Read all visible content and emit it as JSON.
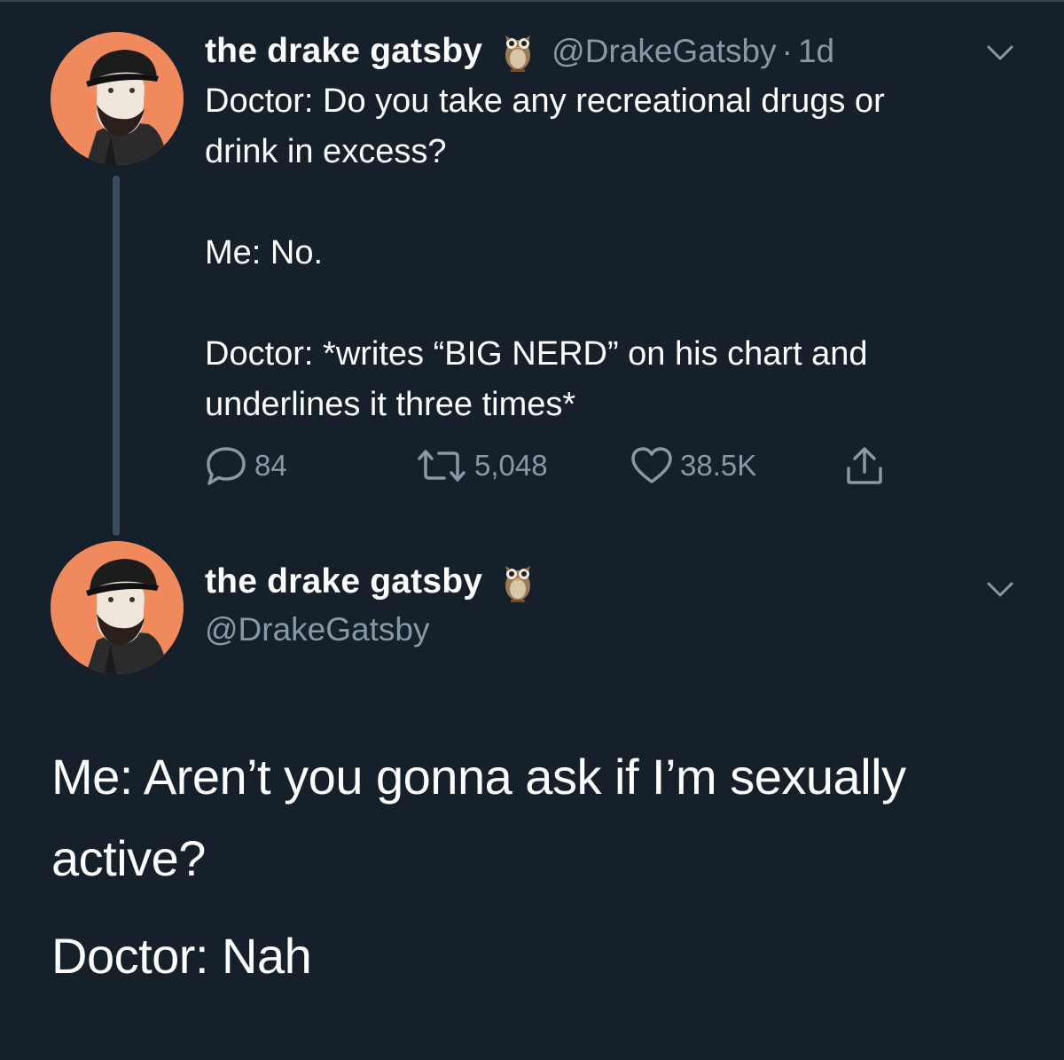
{
  "tweet1": {
    "display_name": "the drake gatsby",
    "emoji_icon": "owl-icon",
    "handle": "@DrakeGatsby",
    "separator": "·",
    "time": "1d",
    "text_lines": [
      "Doctor: Do you take any recreational drugs or",
      "drink in excess?",
      "",
      "Me: No.",
      "",
      "Doctor: *writes “BIG NERD” on his chart and",
      "underlines it three times*"
    ],
    "actions": {
      "replies": "84",
      "retweets": "5,048",
      "likes": "38.5K"
    }
  },
  "tweet2": {
    "display_name": "the drake gatsby",
    "emoji_icon": "owl-icon",
    "handle": "@DrakeGatsby",
    "text_lines": [
      "Me: Aren’t you gonna ask if I’m sexually",
      "active?",
      "Doctor: Nah"
    ]
  },
  "colors": {
    "background": "#15202b",
    "text": "#ffffff",
    "secondary": "#8899a6",
    "avatar_bg": "#f08a5d",
    "thread_line": "#3a4d60"
  }
}
